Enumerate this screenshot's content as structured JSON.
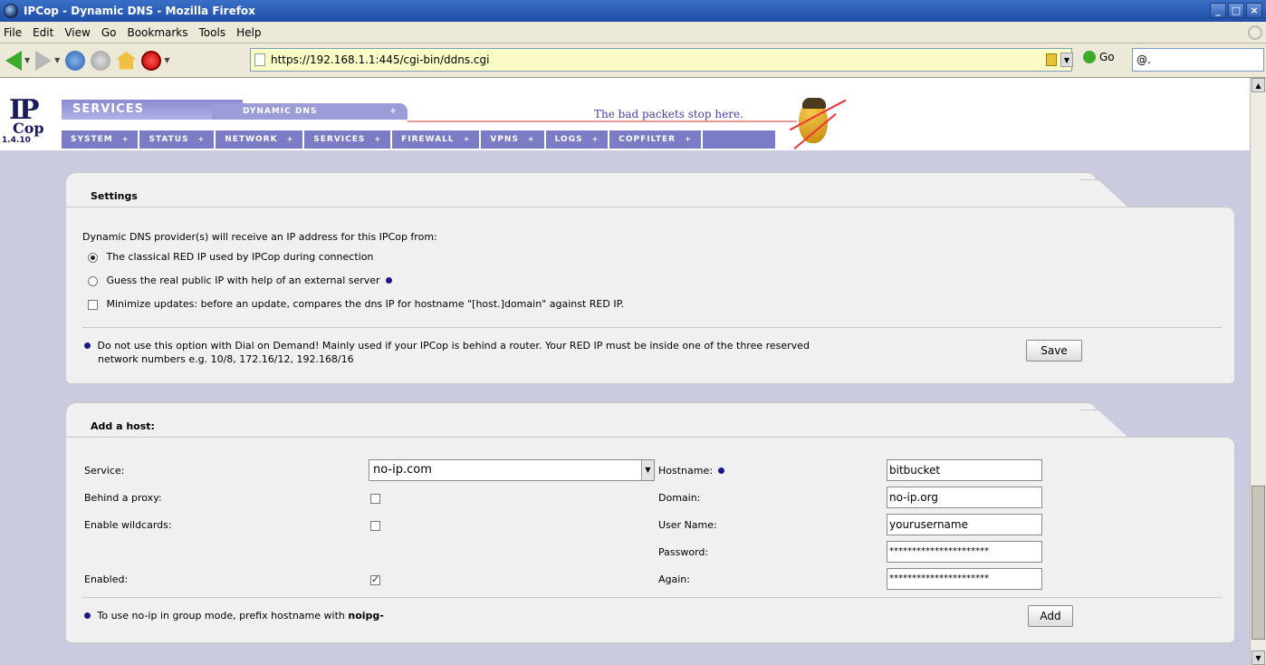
{
  "window": {
    "title": "IPCop - Dynamic DNS - Mozilla Firefox"
  },
  "menu": [
    "File",
    "Edit",
    "View",
    "Go",
    "Bookmarks",
    "Tools",
    "Help"
  ],
  "toolbar": {
    "url": "https://192.168.1.1:445/cgi-bin/ddns.cgi",
    "go_label": "Go",
    "search_prefix": "@."
  },
  "header": {
    "version": "1.4.10",
    "section": "SERVICES",
    "subpage": "DYNAMIC DNS",
    "slogan": "The bad packets stop here.",
    "nav": [
      "SYSTEM",
      "STATUS",
      "NETWORK",
      "SERVICES",
      "FIREWALL",
      "VPNS",
      "LOGS",
      "COPFILTER"
    ]
  },
  "settings": {
    "title": "Settings",
    "intro": "Dynamic DNS provider(s) will receive an IP address for this IPCop from:",
    "option_red": "The classical RED IP used by IPCop during connection",
    "option_external": "Guess the real public IP with help of an external server",
    "minimize": "Minimize updates: before an update, compares the dns IP for hostname \"[host.]domain\" against RED IP.",
    "note_line1": "Do not use this option with Dial on Demand! Mainly used if your IPCop is behind a router. Your RED IP must be inside one of the three reserved",
    "note_line2": "network numbers e.g. 10/8, 172.16/12, 192.168/16",
    "save_label": "Save"
  },
  "addhost": {
    "title": "Add a host:",
    "service_label": "Service:",
    "service_value": "no-ip.com",
    "proxy_label": "Behind a proxy:",
    "wildcards_label": "Enable wildcards:",
    "enabled_label": "Enabled:",
    "hostname_label": "Hostname:",
    "hostname_value": "bitbucket",
    "domain_label": "Domain:",
    "domain_value": "no-ip.org",
    "username_label": "User Name:",
    "username_value": "yourusername",
    "password_label": "Password:",
    "password_value": "**********************",
    "again_label": "Again:",
    "again_value": "**********************",
    "note_text": "To use no-ip in group mode, prefix hostname with",
    "note_bold": "noipg-",
    "add_label": "Add"
  }
}
